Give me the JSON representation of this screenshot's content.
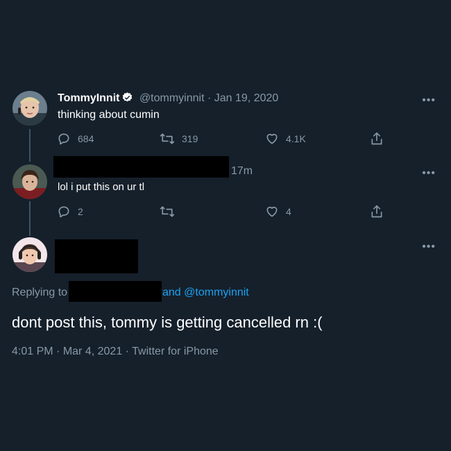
{
  "tweet1": {
    "name": "TommyInnit",
    "handle": "@tommyinnit",
    "sep": "·",
    "date": "Jan 19, 2020",
    "text": "thinking about cumin",
    "replies": "684",
    "retweets": "319",
    "likes": "4.1K"
  },
  "tweet2": {
    "time": "17m",
    "text": "lol i put this on ur tl",
    "replies": "2",
    "retweets": "",
    "likes": "4"
  },
  "tweet3": {
    "replying_prefix": "Replying to",
    "replying_and": "and",
    "replying_handle": "@tommyinnit",
    "text": "dont post this, tommy is getting cancelled rn :(",
    "time": "4:01 PM",
    "sep1": "·",
    "date": "Mar 4, 2021",
    "sep2": "·",
    "source": "Twitter for iPhone"
  },
  "more_icon_glyph": "•••",
  "colors": {
    "background": "#15202b",
    "secondary_text": "#8899a6",
    "link": "#1da1f2",
    "thread_line": "#3d5466"
  }
}
